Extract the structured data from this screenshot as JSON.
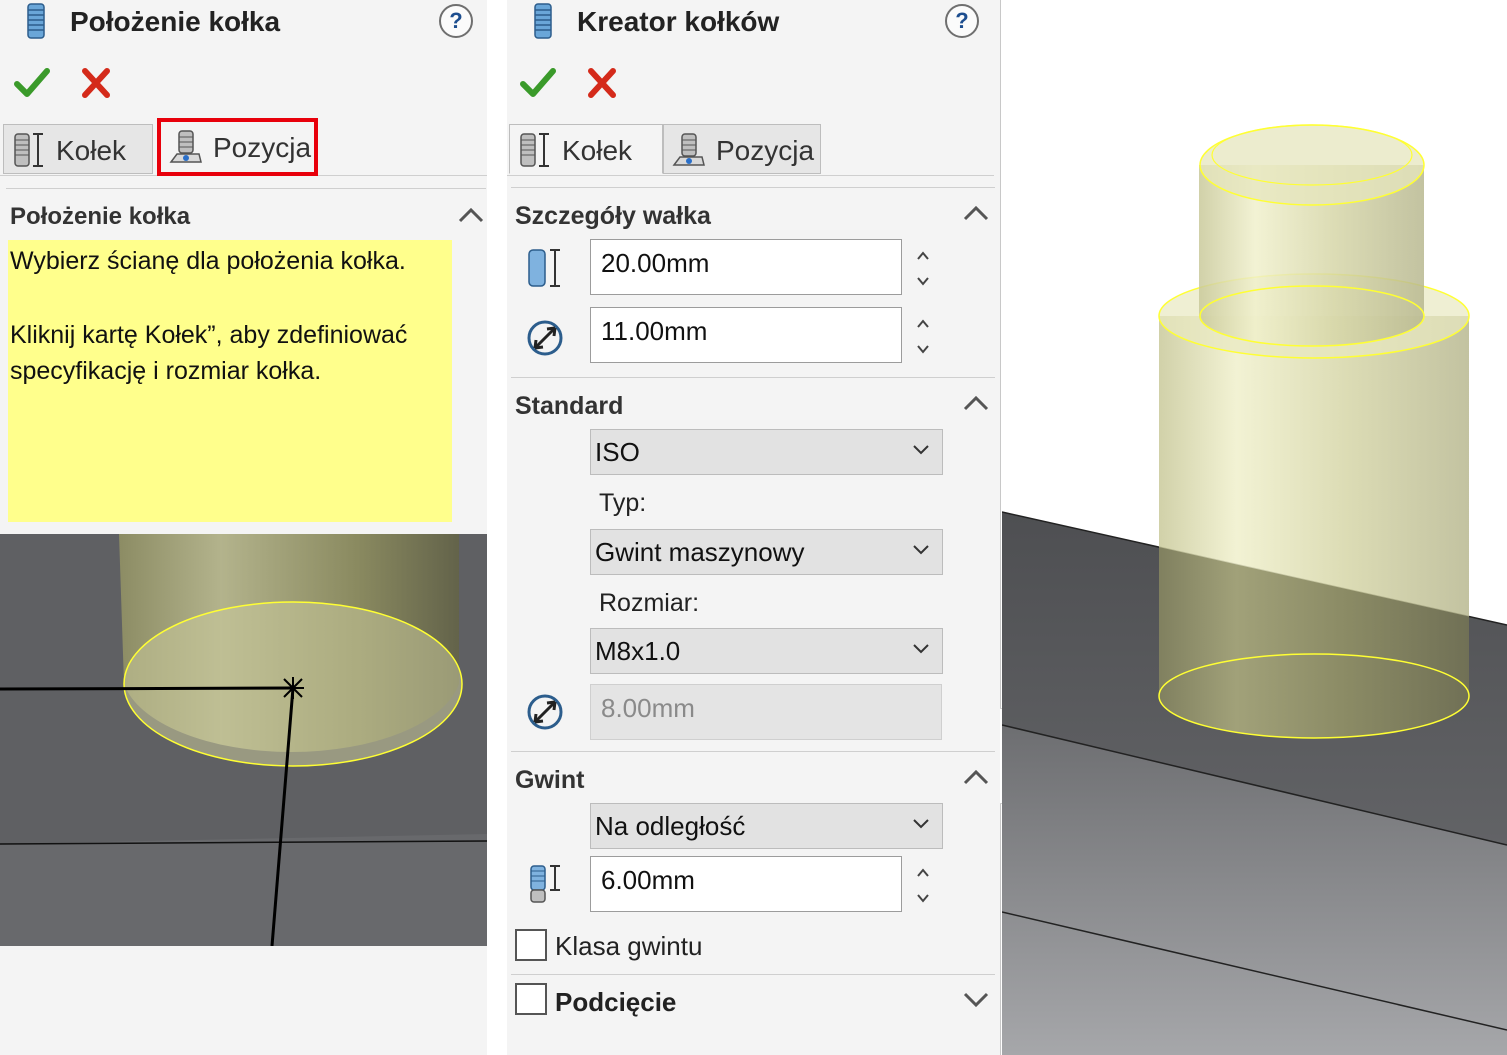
{
  "left_panel": {
    "title": "Położenie kołka",
    "tabs": [
      {
        "label": "Kołek",
        "active": false
      },
      {
        "label": "Pozycja",
        "active": true,
        "highlighted": true
      }
    ],
    "section": {
      "header": "Położenie kołka",
      "message_line1": "Wybierz ścianę dla położenia kołka.",
      "message_line2": "Kliknij kartę Kołek”, aby zdefiniować",
      "message_line3": "specyfikację i rozmiar kołka."
    }
  },
  "right_panel": {
    "title": "Kreator kołków",
    "tabs": [
      {
        "label": "Kołek",
        "active": true
      },
      {
        "label": "Pozycja",
        "active": false
      }
    ],
    "shaft_details": {
      "header": "Szczegóły wałka",
      "length": "20.00mm",
      "diameter": "11.00mm"
    },
    "standard": {
      "header": "Standard",
      "standard_value": "ISO",
      "type_label": "Typ:",
      "type_value": "Gwint maszynowy",
      "size_label": "Rozmiar:",
      "size_value": "M8x1.0",
      "thread_diameter": "8.00mm"
    },
    "thread": {
      "header": "Gwint",
      "end_condition": "Na odległość",
      "thread_length": "6.00mm",
      "thread_class_label": "Klasa gwintu",
      "thread_class_checked": false
    },
    "undercut": {
      "label": "Podcięcie",
      "checked": false
    }
  },
  "colors": {
    "ok_green": "#3a9a2a",
    "cancel_red": "#d42a1a",
    "highlight_red": "#e8000b",
    "message_yellow": "#ffff8c",
    "part_gray": "#5f6063",
    "pin_olive": "#b8b88a",
    "edge_yellow": "#ffff33"
  },
  "icons": [
    "pin-icon",
    "help-icon",
    "ok-check-icon",
    "cancel-x-icon",
    "pin-length-icon",
    "position-icon",
    "diameter-icon",
    "thread-length-icon",
    "chevron-up-icon",
    "chevron-down-icon",
    "spinner-icon"
  ]
}
